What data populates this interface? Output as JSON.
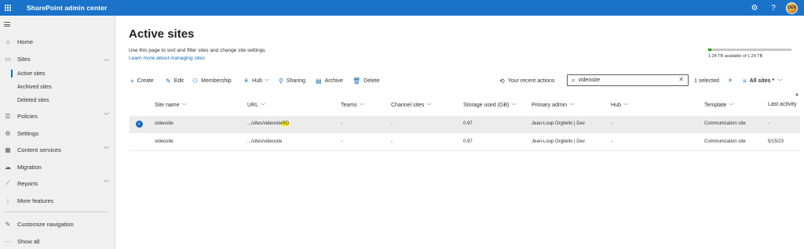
{
  "app": {
    "title": "SharePoint admin center"
  },
  "header": {
    "settings_icon": "gear-icon",
    "help_label": "?",
    "avatar_initials": "DEV"
  },
  "nav": {
    "home": "Home",
    "sites": "Sites",
    "active_sites": "Active sites",
    "archived_sites": "Archived sites",
    "deleted_sites": "Deleted sites",
    "policies": "Policies",
    "settings": "Settings",
    "content_services": "Content services",
    "migration": "Migration",
    "reports": "Reports",
    "more_features": "More features",
    "customize_navigation": "Customize navigation",
    "show_all": "Show all"
  },
  "page": {
    "title": "Active sites",
    "description": "Use this page to sort and filter sites and change site settings.",
    "learn_more": "Learn more about managing sites"
  },
  "storage": {
    "text": "1.24 TB available of 1.24 TB",
    "used_fraction": 0.04,
    "color": "#13a10e"
  },
  "commands": {
    "create": "Create",
    "edit": "Edit",
    "membership": "Membership",
    "hub": "Hub",
    "sharing": "Sharing",
    "archive": "Archive",
    "delete": "Delete",
    "recent_actions": "Your recent actions",
    "search_value": "videosite",
    "selected": "1 selected",
    "view": "All sites *"
  },
  "table": {
    "headers": {
      "site_name": "Site name",
      "url": "URL",
      "teams": "Teams",
      "channel_sites": "Channel sites",
      "storage": "Storage used (GB)",
      "primary_admin": "Primary admin",
      "hub": "Hub",
      "template": "Template",
      "last_activity": "Last activity"
    },
    "rows": [
      {
        "site_name": "videosite",
        "url_prefix": ".../sites/videosite",
        "url_highlight": "RD",
        "teams": "-",
        "channel_sites": "-",
        "storage": "0.97",
        "primary_admin": "Jean-Loup Orgitello | Dev",
        "hub": "-",
        "template": "Communication site",
        "last_activity": "-"
      },
      {
        "site_name": "videosite",
        "url_prefix": ".../sites/videosite",
        "url_highlight": "",
        "teams": "-",
        "channel_sites": "-",
        "storage": "0.97",
        "primary_admin": "Jean-Loup Orgitello | Dev",
        "hub": "-",
        "template": "Communication site",
        "last_activity": "5/15/23"
      }
    ]
  }
}
